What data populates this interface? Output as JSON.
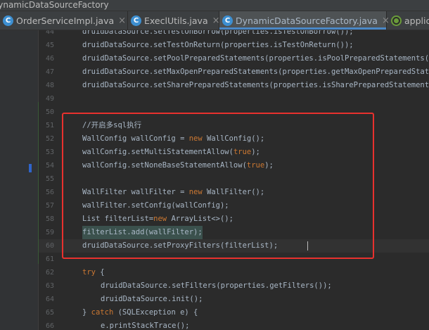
{
  "breadcrumb": {
    "text": "DynamicDataSourceFactory"
  },
  "tabs": [
    {
      "label": "OrderServiceImpl.java",
      "icon": "class-c-icon",
      "close": "×",
      "active": false
    },
    {
      "label": "ExeclUtils.java",
      "icon": "class-c-icon",
      "close": "×",
      "active": false
    },
    {
      "label": "DynamicDataSourceFactory.java",
      "icon": "class-c-icon",
      "close": "×",
      "active": true
    },
    {
      "label": "applic",
      "icon": "spring-leaf-icon",
      "close": "",
      "active": false
    }
  ],
  "code": {
    "lines": [
      {
        "n": "44",
        "t": "druidDataSource.setTestOnBorrow(properties.isTestOnBorrow());"
      },
      {
        "n": "45",
        "t": "druidDataSource.setTestOnReturn(properties.isTestOnReturn());"
      },
      {
        "n": "46",
        "t": "druidDataSource.setPoolPreparedStatements(properties.isPoolPreparedStatements());"
      },
      {
        "n": "47",
        "t": "druidDataSource.setMaxOpenPreparedStatements(properties.getMaxOpenPreparedStatements());"
      },
      {
        "n": "48",
        "t": "druidDataSource.setSharePreparedStatements(properties.isSharePreparedStatements());"
      },
      {
        "n": "49",
        "t": ""
      },
      {
        "n": "50",
        "t": ""
      },
      {
        "n": "51",
        "t": "//开启多sql执行"
      },
      {
        "n": "52",
        "t": "WallConfig wallConfig = new WallConfig();"
      },
      {
        "n": "53",
        "t": "wallConfig.setMultiStatementAllow(true);"
      },
      {
        "n": "54",
        "t": "wallConfig.setNoneBaseStatementAllow(true);"
      },
      {
        "n": "55",
        "t": ""
      },
      {
        "n": "56",
        "t": "WallFilter wallFilter = new WallFilter();"
      },
      {
        "n": "57",
        "t": "wallFilter.setConfig(wallConfig);"
      },
      {
        "n": "58",
        "t": "List filterList=new ArrayList<>();"
      },
      {
        "n": "59",
        "t": "filterList.add(wallFilter);"
      },
      {
        "n": "60",
        "t": "druidDataSource.setProxyFilters(filterList);"
      },
      {
        "n": "61",
        "t": ""
      },
      {
        "n": "62",
        "t": "try {"
      },
      {
        "n": "63",
        "t": "druidDataSource.setFilters(properties.getFilters());"
      },
      {
        "n": "64",
        "t": "druidDataSource.init();"
      },
      {
        "n": "65",
        "t": "} catch (SQLException e) {"
      },
      {
        "n": "66",
        "t": "e.printStackTrace();"
      }
    ]
  },
  "colors": {
    "background": "#2b2b2b",
    "keyword": "#cc7832",
    "comment": "#808080",
    "text": "#a9b7c6",
    "annotation_box": "#e8312e"
  }
}
